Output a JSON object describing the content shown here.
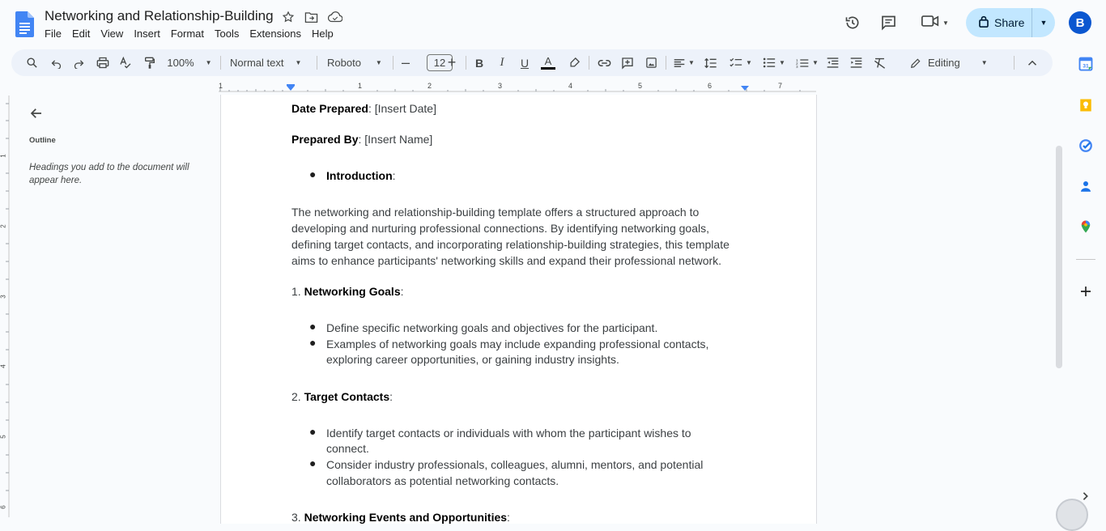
{
  "app": {
    "title": "Networking and Relationship-Building",
    "menu": [
      "File",
      "Edit",
      "View",
      "Insert",
      "Format",
      "Tools",
      "Extensions",
      "Help"
    ],
    "share_label": "Share",
    "avatar_letter": "B"
  },
  "toolbar": {
    "zoom": "100%",
    "style": "Normal text",
    "font": "Roboto",
    "font_size": "12",
    "mode": "Editing"
  },
  "ruler": {
    "numbers": [
      "1",
      "1",
      "2",
      "3",
      "4",
      "5",
      "6",
      "7"
    ]
  },
  "vruler": {
    "numbers": [
      "1",
      "2",
      "3",
      "4",
      "5",
      "6"
    ]
  },
  "outline": {
    "title": "Outline",
    "hint": "Headings you add to the document will appear here."
  },
  "document": {
    "date_label": "Date Prepared",
    "date_value": ": [Insert Date]",
    "prepared_label": "Prepared By",
    "prepared_value": ": [Insert Name]",
    "intro_label": "Introduction",
    "intro_colon": ":",
    "intro_lines": [
      "The networking and relationship-building template offers a structured approach to",
      "developing and nurturing professional connections. By identifying networking goals,",
      "defining target contacts, and incorporating relationship-building strategies, this template",
      "aims to enhance participants' networking skills and expand their professional network."
    ],
    "section1_num": "1. ",
    "section1_label": "Networking Goals",
    "section1_colon": ":",
    "section1_items": [
      "Define specific networking goals and objectives for the participant.",
      "Examples of networking goals may include expanding professional contacts,",
      "exploring career opportunities, or gaining industry insights."
    ],
    "section2_num": "2. ",
    "section2_label": "Target Contacts",
    "section2_colon": ":",
    "section2_items": [
      "Identify target contacts or individuals with whom the participant wishes to",
      "connect.",
      "Consider industry professionals, colleagues, alumni, mentors, and potential",
      "collaborators as potential networking contacts."
    ],
    "section3_num": "3. ",
    "section3_label": "Networking Events and Opportunities",
    "section3_colon": ":"
  },
  "colors": {
    "accent": "#0b57d0",
    "share_bg": "#c2e7ff",
    "toolbar_bg": "#edf2fa",
    "docs_blue": "#4285f4"
  }
}
